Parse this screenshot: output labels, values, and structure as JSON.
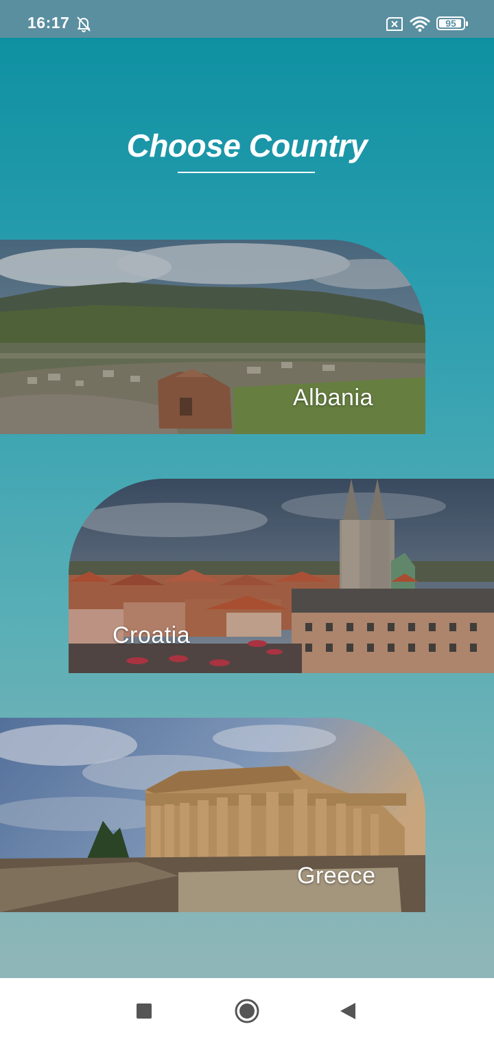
{
  "status_bar": {
    "time": "16:17",
    "battery": "95",
    "battery_level": 0.95,
    "icons": [
      "bell-off-icon",
      "sim-off-icon",
      "wifi-icon",
      "battery-icon"
    ]
  },
  "page": {
    "title": "Choose Country"
  },
  "countries": [
    {
      "name": "Albania",
      "image": "albania-landscape"
    },
    {
      "name": "Croatia",
      "image": "zagreb-cityscape"
    },
    {
      "name": "Greece",
      "image": "parthenon"
    }
  ],
  "nav_bar": {
    "buttons": [
      "recent-apps",
      "home",
      "back"
    ]
  },
  "colors": {
    "background_top": "#0a8fa0",
    "background_bottom": "#8eb6b8",
    "status_bar": "#5a8fa0",
    "text": "#ffffff"
  }
}
